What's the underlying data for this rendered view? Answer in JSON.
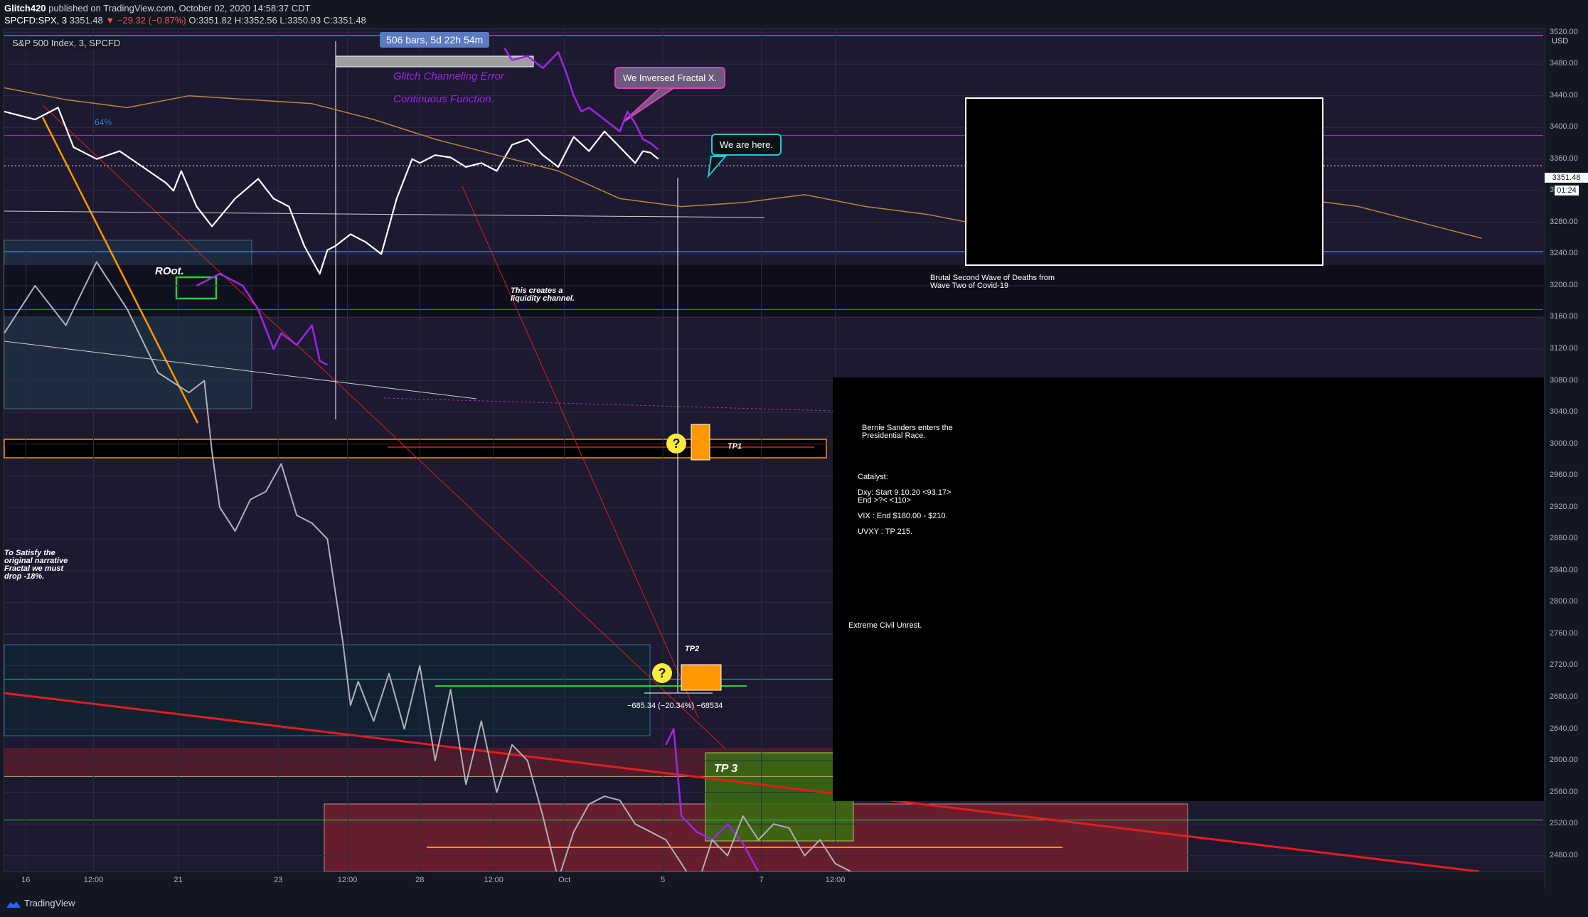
{
  "header": {
    "author": "Glitch420",
    "published_text": " published on TradingView.com, October 02, 2020 14:58:37 CDT",
    "symbol": "SPCFD:SPX, 3",
    "last": "3351.48",
    "change": "▼ −29.32 (−0.87%)",
    "o": "O:3351.82",
    "h": "H:3352.56",
    "l": "L:3350.93",
    "c": "C:3351.48"
  },
  "legend": "S&P 500 Index, 3, SPCFD",
  "currency": "USD",
  "last_price_label": "3351.48",
  "countdown": "01:24",
  "bars_range": "506 bars, 5d 22h 54m",
  "annotations": {
    "glitch_error": "Glitch Channeling Error",
    "continuous": "Continuous Function.",
    "inversed": "We Inversed Fractal X.",
    "here": "We are here.",
    "root": "ROot.",
    "liquidity_1": "This creates a",
    "liquidity_2": "liquidity channel.",
    "satisfy_1": "To Satisfy the",
    "satisfy_2": "original narrative",
    "satisfy_3": "Fractal we must",
    "satisfy_4": "drop -18%.",
    "wave_1": "Brutal Second Wave of Deaths from",
    "wave_2": "Wave Two of Covid-19",
    "bernie_1": "Bernie Sanders enters the",
    "bernie_2": "Presidential Race.",
    "catalyst": "Catalyst:",
    "dxy_1": "Dxy: Start 9.10.20 <93.17>",
    "dxy_2": "End >?< <110>",
    "vix": "VIX : End $180.00 - $210.",
    "uvxy": "UVXY : TP 215.",
    "unrest": "Extreme Civil Unrest.",
    "tp1": "TP1",
    "tp2": "TP2",
    "tp3": "TP 3",
    "measure": "−685.34 (−20.34%) −68534",
    "fib": "64%",
    "question": "?"
  },
  "footer_brand": "TradingView",
  "colors": {
    "price_line": "#ffffff",
    "projection": "#9c27e0",
    "fractal_overlay": "#b0b0b8",
    "moving_average": "#b8893a",
    "trend_red": "#e01e1e",
    "orange": "#ff9800",
    "green": "#2ecc40"
  },
  "chart_data": {
    "type": "line",
    "title": "S&P 500 Index, 3, SPCFD",
    "xlabel": "",
    "ylabel": "",
    "ylim": [
      2460,
      3525
    ],
    "y_ticks": [
      "3520.00",
      "3480.00",
      "3440.00",
      "3400.00",
      "3360.00",
      "3320.00",
      "3280.00",
      "3240.00",
      "3200.00",
      "3160.00",
      "3120.00",
      "3080.00",
      "3040.00",
      "3000.00",
      "2960.00",
      "2920.00",
      "2880.00",
      "2840.00",
      "2800.00",
      "2760.00",
      "2720.00",
      "2680.00",
      "2640.00",
      "2600.00",
      "2560.00",
      "2520.00",
      "2480.00"
    ],
    "x_ticks": [
      "16",
      "12:00",
      "21",
      "23",
      "12:00",
      "28",
      "12:00",
      "Oct",
      "5",
      "7",
      "12:00"
    ],
    "x_tick_pos": [
      0.014,
      0.058,
      0.113,
      0.178,
      0.223,
      0.27,
      0.318,
      0.364,
      0.428,
      0.492,
      0.54
    ],
    "series": [
      {
        "x": [
          0,
          0.02,
          0.035,
          0.045,
          0.06,
          0.075,
          0.09,
          0.105,
          0.11,
          0.115,
          0.125,
          0.135,
          0.15,
          0.165,
          0.175,
          0.185,
          0.195,
          0.205,
          0.21,
          0.215,
          0.225,
          0.235,
          0.245,
          0.255,
          0.265,
          0.27,
          0.28,
          0.29,
          0.3,
          0.31,
          0.32,
          0.33,
          0.34,
          0.35,
          0.36,
          0.37,
          0.38,
          0.39,
          0.4,
          0.41,
          0.415,
          0.42,
          0.425
        ],
        "values": [
          3420,
          3410,
          3425,
          3375,
          3360,
          3370,
          3350,
          3330,
          3320,
          3345,
          3300,
          3275,
          3310,
          3335,
          3310,
          3300,
          3250,
          3215,
          3245,
          3250,
          3265,
          3255,
          3240,
          3310,
          3360,
          3355,
          3365,
          3362,
          3350,
          3355,
          3345,
          3378,
          3385,
          3365,
          3350,
          3388,
          3370,
          3395,
          3375,
          3355,
          3370,
          3368,
          3360
        ]
      },
      {
        "x": [
          0.125,
          0.14,
          0.155,
          0.165,
          0.175,
          0.18,
          0.19,
          0.2,
          0.205,
          0.21
        ],
        "values": [
          3200,
          3215,
          3200,
          3170,
          3120,
          3140,
          3125,
          3150,
          3105,
          3100
        ]
      },
      {
        "x": [
          0.325,
          0.33,
          0.34,
          0.35,
          0.36,
          0.365,
          0.37,
          0.375,
          0.38,
          0.39,
          0.4,
          0.405,
          0.41,
          0.415,
          0.42,
          0.425
        ],
        "values": [
          3500,
          3485,
          3490,
          3475,
          3495,
          3470,
          3440,
          3420,
          3425,
          3410,
          3395,
          3420,
          3405,
          3385,
          3380,
          3372
        ]
      },
      {
        "x": [
          0.43,
          0.435,
          0.44,
          0.45,
          0.46,
          0.47,
          0.48,
          0.49,
          0.5,
          0.51,
          0.515
        ],
        "values": [
          2620,
          2640,
          2530,
          2510,
          2500,
          2520,
          2495,
          2460,
          2445,
          2455,
          2440
        ]
      },
      {
        "x": [
          0,
          0.02,
          0.04,
          0.06,
          0.08,
          0.1,
          0.12,
          0.13,
          0.135,
          0.14,
          0.15,
          0.16,
          0.17,
          0.18,
          0.19,
          0.2,
          0.21,
          0.22,
          0.225,
          0.23,
          0.24,
          0.25,
          0.26,
          0.27,
          0.28,
          0.29,
          0.3,
          0.31,
          0.32,
          0.33,
          0.34,
          0.35,
          0.36,
          0.37,
          0.38,
          0.39,
          0.4,
          0.41,
          0.42,
          0.43,
          0.44,
          0.45,
          0.46,
          0.47,
          0.48,
          0.49,
          0.5,
          0.51,
          0.52,
          0.53,
          0.54,
          0.55
        ],
        "values": [
          3140,
          3200,
          3150,
          3230,
          3170,
          3090,
          3065,
          3080,
          2990,
          2920,
          2890,
          2930,
          2940,
          2975,
          2910,
          2900,
          2880,
          2750,
          2670,
          2700,
          2650,
          2710,
          2640,
          2720,
          2600,
          2690,
          2570,
          2650,
          2560,
          2620,
          2600,
          2530,
          2450,
          2510,
          2545,
          2555,
          2550,
          2520,
          2510,
          2500,
          2470,
          2440,
          2500,
          2480,
          2530,
          2500,
          2520,
          2515,
          2480,
          2500,
          2470,
          2460
        ]
      },
      {
        "x": [
          0,
          0.04,
          0.08,
          0.12,
          0.16,
          0.2,
          0.24,
          0.28,
          0.32,
          0.36,
          0.4,
          0.44,
          0.48,
          0.52,
          0.56,
          0.6,
          0.64,
          0.68,
          0.72,
          0.76,
          0.8,
          0.84,
          0.88,
          0.92,
          0.96
        ],
        "values": [
          3450,
          3435,
          3425,
          3440,
          3435,
          3430,
          3410,
          3385,
          3365,
          3345,
          3310,
          3300,
          3305,
          3315,
          3300,
          3290,
          3275,
          3260,
          3245,
          3250,
          3290,
          3310,
          3300,
          3280,
          3260
        ]
      }
    ]
  }
}
